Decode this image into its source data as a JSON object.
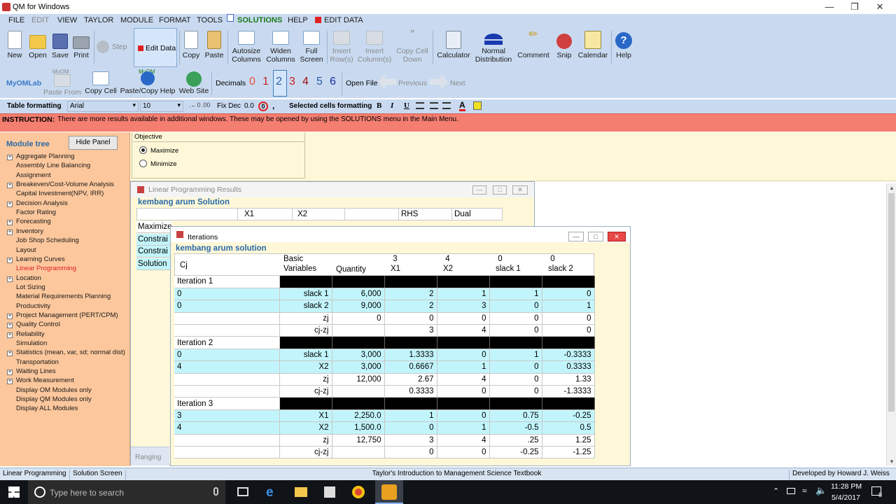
{
  "app": {
    "title": "QM for Windows"
  },
  "menu": [
    {
      "label": "FILE",
      "dim": false
    },
    {
      "label": "EDIT",
      "dim": true
    },
    {
      "label": "VIEW",
      "dim": false
    },
    {
      "label": "TAYLOR",
      "dim": false
    },
    {
      "label": "MODULE",
      "dim": false
    },
    {
      "label": "FORMAT",
      "dim": false
    },
    {
      "label": "TOOLS",
      "dim": false
    },
    {
      "label": "SOLUTIONS",
      "dim": false,
      "sol": true
    },
    {
      "label": "HELP",
      "dim": false
    },
    {
      "label": "EDIT DATA",
      "dim": false,
      "red": true
    }
  ],
  "toolbar1": {
    "new": "New",
    "open": "Open",
    "save": "Save",
    "print": "Print",
    "step": "Step",
    "edit_data": "Edit Data",
    "copy": "Copy",
    "paste": "Paste",
    "autosize_1": "Autosize",
    "autosize_2": "Columns",
    "widen_1": "Widen",
    "widen_2": "Columns",
    "full_1": "Full",
    "full_2": "Screen",
    "insrow_1": "Insert",
    "insrow_2": "Row(s)",
    "inscol_1": "Insert",
    "inscol_2": "Column(s)",
    "copydown_1": "Copy Cell",
    "copydown_2": "Down",
    "calculator": "Calculator",
    "normal_1": "Normal",
    "normal_2": "Distribution",
    "comment": "Comment",
    "snip": "Snip",
    "calendar": "Calendar",
    "help": "Help"
  },
  "toolbar2": {
    "myomlab": "MyOMLab",
    "myom_small": "MyOM",
    "paste_from": "Paste From",
    "copy_cell": "Copy Cell",
    "paste_copy_help": "Paste/Copy Help",
    "web_site": "Web Site",
    "decimals_label": "Decimals",
    "decimals": [
      "0",
      "1",
      "2",
      "3",
      "4",
      "5",
      "6"
    ],
    "decimals_selected": "2",
    "open_file": "Open File",
    "previous": "Previous",
    "next": "Next"
  },
  "toolbar3": {
    "table_formatting": "Table formatting",
    "font": "Arial",
    "size": "10",
    "fix_dec_label": "Fix Dec",
    "fix_dec_value": "0.0",
    "comma": ",",
    "selected_cells": "Selected cells formatting",
    "bold": "B",
    "italic": "I",
    "underline": "U",
    "font_color": "A"
  },
  "instruction": {
    "label": "INSTRUCTION:",
    "text": "There are more results available in additional windows. These may be opened by using the SOLUTIONS menu in the Main Menu."
  },
  "sidebar": {
    "title": "Module tree",
    "hide_panel": "Hide Panel",
    "items": [
      {
        "label": "Aggregate Planning",
        "exp": true
      },
      {
        "label": "Assembly Line Balancing",
        "exp": false
      },
      {
        "label": "Assignment",
        "exp": false
      },
      {
        "label": "Breakeven/Cost-Volume Analysis",
        "exp": true
      },
      {
        "label": "Capital Investment(NPV, IRR)",
        "exp": false
      },
      {
        "label": "Decision Analysis",
        "exp": true
      },
      {
        "label": "Factor Rating",
        "exp": false
      },
      {
        "label": "Forecasting",
        "exp": true
      },
      {
        "label": "Inventory",
        "exp": true
      },
      {
        "label": "Job Shop Scheduling",
        "exp": false
      },
      {
        "label": "Layout",
        "exp": false
      },
      {
        "label": "Learning Curves",
        "exp": true
      },
      {
        "label": "Linear Programming",
        "exp": false,
        "sel": true
      },
      {
        "label": "Location",
        "exp": true
      },
      {
        "label": "Lot Sizing",
        "exp": false
      },
      {
        "label": "Material Requirements Planning",
        "exp": false
      },
      {
        "label": "Productivity",
        "exp": false
      },
      {
        "label": "Project Management (PERT/CPM)",
        "exp": true
      },
      {
        "label": "Quality Control",
        "exp": true
      },
      {
        "label": "Reliability",
        "exp": true
      },
      {
        "label": "Simulation",
        "exp": false
      },
      {
        "label": "Statistics (mean, var, sd; normal dist)",
        "exp": true
      },
      {
        "label": "Transportation",
        "exp": false
      },
      {
        "label": "Waiting Lines",
        "exp": true
      },
      {
        "label": "Work Measurement",
        "exp": true
      },
      {
        "label": "Display OM Modules only",
        "exp": false
      },
      {
        "label": "Display QM Modules only",
        "exp": false
      },
      {
        "label": "Display ALL Modules",
        "exp": false
      }
    ]
  },
  "objective": {
    "label": "Objective",
    "maximize": "Maximize",
    "minimize": "Minimize",
    "selected": "Maximize"
  },
  "lp_results": {
    "title": "Linear Programming Results",
    "solution_title": "kembang arum Solution",
    "headers": [
      "",
      "X1",
      "X2",
      "",
      "RHS",
      "Dual"
    ],
    "rows": [
      "Maximize",
      "Constrai",
      "Constrai",
      "Solution"
    ],
    "ranging": "Ranging"
  },
  "iterations": {
    "title": "Iterations",
    "solution_title": "kembang arum solution",
    "headers": {
      "cj": "Cj",
      "basic_1": "Basic",
      "basic_2": "Variables",
      "quantity": "Quantity",
      "x1_top": "3",
      "x1": "X1",
      "x2_top": "4",
      "x2": "X2",
      "s1_top": "0",
      "s1": "slack 1",
      "s2_top": "0",
      "s2": "slack 2"
    },
    "rows": [
      {
        "type": "iter",
        "label": "Iteration 1"
      },
      {
        "type": "data",
        "cj": "0",
        "basic": "slack 1",
        "q": "6,000",
        "x1": "2",
        "x2": "1",
        "s1": "1",
        "s2": "0"
      },
      {
        "type": "data",
        "cj": "0",
        "basic": "slack 2",
        "q": "9,000",
        "x1": "2",
        "x2": "3",
        "s1": "0",
        "s2": "1"
      },
      {
        "type": "data",
        "cj": "",
        "basic": "zj",
        "q": "0",
        "x1": "0",
        "x2": "0",
        "s1": "0",
        "s2": "0"
      },
      {
        "type": "data",
        "cj": "",
        "basic": "cj-zj",
        "q": "",
        "x1": "3",
        "x2": "4",
        "s1": "0",
        "s2": "0"
      },
      {
        "type": "iter",
        "label": "Iteration 2"
      },
      {
        "type": "data",
        "cj": "0",
        "basic": "slack 1",
        "q": "3,000",
        "x1": "1.3333",
        "x2": "0",
        "s1": "1",
        "s2": "-0.3333"
      },
      {
        "type": "data",
        "cj": "4",
        "basic": "X2",
        "q": "3,000",
        "x1": "0.6667",
        "x2": "1",
        "s1": "0",
        "s2": "0.3333"
      },
      {
        "type": "data",
        "cj": "",
        "basic": "zj",
        "q": "12,000",
        "x1": "2.67",
        "x2": "4",
        "s1": "0",
        "s2": "1.33"
      },
      {
        "type": "data",
        "cj": "",
        "basic": "cj-zj",
        "q": "",
        "x1": "0.3333",
        "x2": "0",
        "s1": "0",
        "s2": "-1.3333"
      },
      {
        "type": "iter",
        "label": "Iteration 3"
      },
      {
        "type": "data",
        "cj": "3",
        "basic": "X1",
        "q": "2,250.0",
        "x1": "1",
        "x2": "0",
        "s1": "0.75",
        "s2": "-0.25"
      },
      {
        "type": "data",
        "cj": "4",
        "basic": "X2",
        "q": "1,500.0",
        "x1": "0",
        "x2": "1",
        "s1": "-0.5",
        "s2": "0.5"
      },
      {
        "type": "data",
        "cj": "",
        "basic": "zj",
        "q": "12,750",
        "x1": "3",
        "x2": "4",
        "s1": ".25",
        "s2": "1.25"
      },
      {
        "type": "data",
        "cj": "",
        "basic": "cj-zj",
        "q": "",
        "x1": "0",
        "x2": "0",
        "s1": "-0.25",
        "s2": "-1.25"
      }
    ]
  },
  "statusbar": {
    "module": "Linear Programming",
    "screen": "Solution Screen",
    "textbook": "Taylor's Introduction to Management Science Textbook",
    "developer": "Developed by Howard J. Weiss"
  },
  "taskbar": {
    "search_placeholder": "Type here to search",
    "time": "11:28 PM",
    "date": "5/4/2017",
    "notif_count": "8"
  },
  "colors": {
    "menubar": "#c9daf0",
    "instruction": "#f47e70",
    "sidebar": "#fcc79c",
    "row_cyan": "#c2f5fb",
    "black_bar": "#000000",
    "title_blue": "#2a6aa8"
  }
}
